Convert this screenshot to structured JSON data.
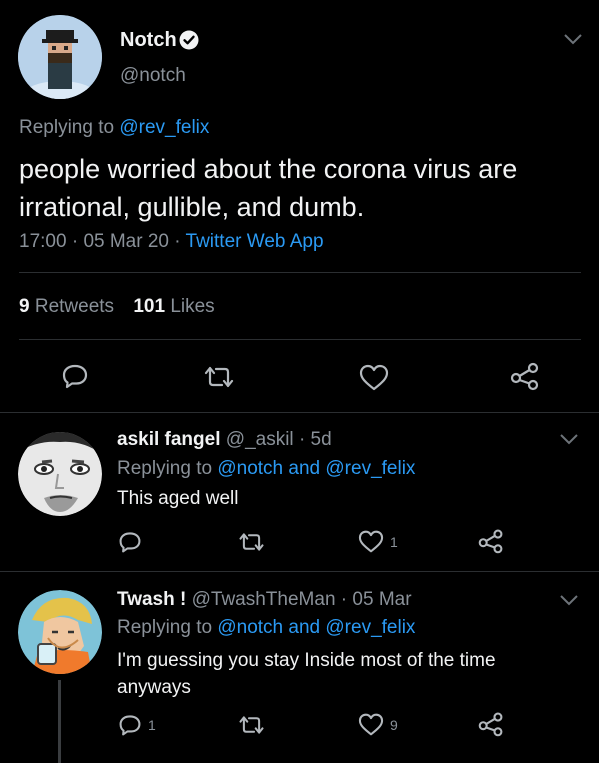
{
  "main_tweet": {
    "name": "Notch",
    "handle": "@notch",
    "reply_prefix": "Replying to",
    "reply_to": "@rev_felix",
    "text_line1": "people worried about the corona virus are",
    "text_line2": "irrational, gullible, and dumb.",
    "time": "17:00",
    "sep": "·",
    "date": "05 Mar 20",
    "source": "Twitter Web App",
    "retweets_count": "9",
    "retweets_label": "Retweets",
    "likes_count": "101",
    "likes_label": "Likes"
  },
  "replies": [
    {
      "name": "askil fangel",
      "handle": "@_askil",
      "meta": "· 5d",
      "reply_prefix": "Replying to",
      "mention1": "@notch",
      "and": "and",
      "mention2": "@rev_felix",
      "text": "This aged well",
      "reply_count": "",
      "like_count": "1"
    },
    {
      "name": "Twash !",
      "handle": "@TwashTheMan",
      "meta": "· 05 Mar",
      "reply_prefix": "Replying to",
      "mention1": "@notch",
      "and": "and",
      "mention2": "@rev_felix",
      "text_line1": "I'm guessing you stay Inside most of the time",
      "text_line2": "anyways",
      "reply_count": "1",
      "like_count": "9"
    }
  ],
  "colors": {
    "background": "#000000",
    "link": "#2b9af3",
    "secondary_text": "#8a9199",
    "divider": "#2b2e31"
  },
  "icons": [
    "verified-badge-icon",
    "chevron-down-icon",
    "reply-icon",
    "retweet-icon",
    "like-icon",
    "share-icon"
  ]
}
